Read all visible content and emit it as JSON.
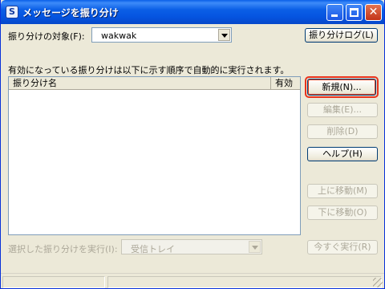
{
  "window": {
    "title": "メッセージを振り分け",
    "app_icon_glyph": "S"
  },
  "filter_target": {
    "label": "振り分けの対象(F):",
    "value": "wakwak"
  },
  "log_button": "振り分けログ(L)",
  "description": "有効になっている振り分けは以下に示す順序で自動的に実行されます。",
  "list": {
    "columns": [
      "振り分け名",
      "有効"
    ],
    "rows": []
  },
  "buttons": {
    "new": "新規(N)...",
    "edit": "編集(E)...",
    "delete": "削除(D)",
    "help": "ヘルプ(H)",
    "move_up": "上に移動(M)",
    "move_down": "下に移動(O)",
    "run_now": "今すぐ実行(R)"
  },
  "run_on": {
    "label": "選択した振り分けを実行(I):",
    "value": "受信トレイ"
  },
  "colors": {
    "titlebar": "#0554e0",
    "face": "#ece9d8",
    "focus_ring": "#e8331c"
  }
}
